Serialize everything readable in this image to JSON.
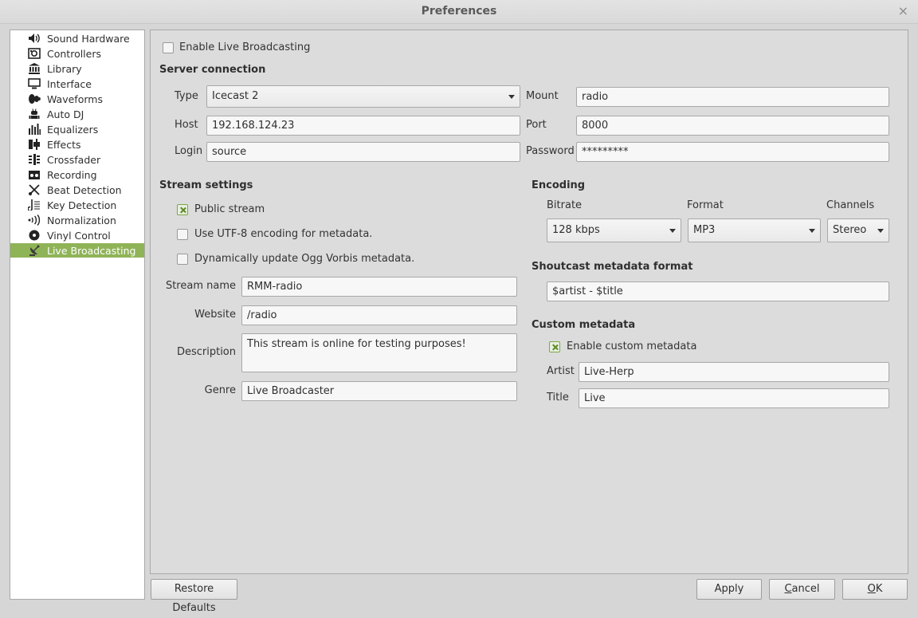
{
  "window": {
    "title": "Preferences",
    "close_glyph": "×"
  },
  "sidebar": {
    "items": [
      {
        "label": "Sound Hardware",
        "icon": "speaker-icon"
      },
      {
        "label": "Controllers",
        "icon": "controller-icon"
      },
      {
        "label": "Library",
        "icon": "library-icon"
      },
      {
        "label": "Interface",
        "icon": "monitor-icon"
      },
      {
        "label": "Waveforms",
        "icon": "waveform-icon"
      },
      {
        "label": "Auto DJ",
        "icon": "robot-icon"
      },
      {
        "label": "Equalizers",
        "icon": "equalizer-icon"
      },
      {
        "label": "Effects",
        "icon": "effects-icon"
      },
      {
        "label": "Crossfader",
        "icon": "crossfader-icon"
      },
      {
        "label": "Recording",
        "icon": "recording-icon"
      },
      {
        "label": "Beat Detection",
        "icon": "beat-detection-icon"
      },
      {
        "label": "Key Detection",
        "icon": "key-detection-icon"
      },
      {
        "label": "Normalization",
        "icon": "normalization-icon"
      },
      {
        "label": "Vinyl Control",
        "icon": "vinyl-icon"
      },
      {
        "label": "Live Broadcasting",
        "icon": "satellite-dish-icon",
        "selected": true
      }
    ]
  },
  "live": {
    "enable_label": "Enable Live Broadcasting",
    "enable_checked": false,
    "server": {
      "heading": "Server connection",
      "type_label": "Type",
      "type_value": "Icecast 2",
      "mount_label": "Mount",
      "mount_value": "radio",
      "host_label": "Host",
      "host_value": "192.168.124.23",
      "port_label": "Port",
      "port_value": "8000",
      "login_label": "Login",
      "login_value": "source",
      "password_label": "Password",
      "password_value": "*********"
    },
    "stream": {
      "heading": "Stream settings",
      "public_label": "Public stream",
      "public_checked": true,
      "utf8_label": "Use UTF-8 encoding for metadata.",
      "utf8_checked": false,
      "ogg_label": "Dynamically update Ogg Vorbis metadata.",
      "ogg_checked": false,
      "name_label": "Stream name",
      "name_value": "RMM-radio",
      "website_label": "Website",
      "website_value": "/radio",
      "description_label": "Description",
      "description_value": "This stream is online for testing purposes!",
      "genre_label": "Genre",
      "genre_value": "Live Broadcaster"
    },
    "encoding": {
      "heading": "Encoding",
      "bitrate_label": "Bitrate",
      "bitrate_value": "128 kbps",
      "format_label": "Format",
      "format_value": "MP3",
      "channels_label": "Channels",
      "channels_value": "Stereo"
    },
    "shoutcast": {
      "heading": "Shoutcast metadata format",
      "value": "$artist - $title"
    },
    "custom": {
      "heading": "Custom metadata",
      "enable_label": "Enable custom metadata",
      "enable_checked": true,
      "artist_label": "Artist",
      "artist_value": "Live-Herp",
      "title_label": "Title",
      "title_value": "Live"
    }
  },
  "buttons": {
    "restore": "Restore Defaults",
    "apply": "Apply",
    "cancel_mnemonic": "C",
    "cancel_rest": "ancel",
    "ok_mnemonic": "O",
    "ok_rest": "K"
  },
  "colors": {
    "accent": "#8fb357",
    "panel": "#dcdcdc",
    "sidebar_bg": "#ffffff"
  }
}
